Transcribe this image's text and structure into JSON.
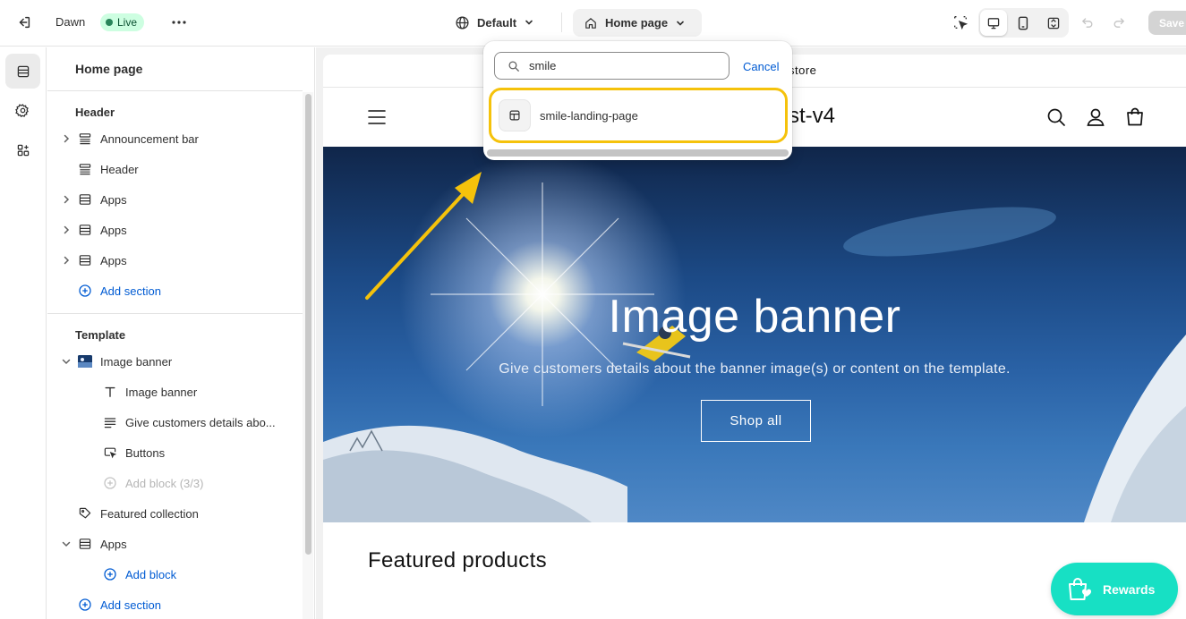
{
  "topbar": {
    "theme_name": "Dawn",
    "status_badge": "Live",
    "locale_label": "Default",
    "page_selector_label": "Home page",
    "save_label": "Save"
  },
  "sidebar": {
    "title": "Home page",
    "header_group": "Header",
    "header_items": [
      {
        "label": "Announcement bar",
        "icon": "section-icon",
        "expandable": true
      },
      {
        "label": "Header",
        "icon": "section-icon",
        "expandable": false
      },
      {
        "label": "Apps",
        "icon": "apps-section-icon",
        "expandable": true
      },
      {
        "label": "Apps",
        "icon": "apps-section-icon",
        "expandable": true
      },
      {
        "label": "Apps",
        "icon": "apps-section-icon",
        "expandable": true
      }
    ],
    "header_add_section": "Add section",
    "template_group": "Template",
    "template_items": [
      {
        "label": "Image banner",
        "icon": "image-thumbnail",
        "expanded": true
      },
      {
        "label": "Image banner",
        "icon": "text-icon",
        "child": true
      },
      {
        "label": "Give customers details abo...",
        "icon": "paragraph-icon",
        "child": true
      },
      {
        "label": "Buttons",
        "icon": "button-cursor-icon",
        "child": true
      },
      {
        "label": "Add block (3/3)",
        "icon": "plus-circle-icon",
        "child": true,
        "disabled": true
      },
      {
        "label": "Featured collection",
        "icon": "tag-icon"
      },
      {
        "label": "Apps",
        "icon": "apps-section-icon",
        "expanded": true
      },
      {
        "label": "Add block",
        "icon": "plus-circle-icon",
        "child": true,
        "link": true
      }
    ],
    "template_add_section": "Add section"
  },
  "dropdown": {
    "search_value": "smile",
    "cancel_label": "Cancel",
    "result_label": "smile-landing-page",
    "highlight_color": "#f5c20b"
  },
  "preview": {
    "announcement_text": "store",
    "store_name": "st-v4",
    "banner_title": "Image banner",
    "banner_subtitle": "Give customers details about the banner image(s) or content on the template.",
    "banner_button": "Shop all",
    "featured_heading": "Featured products",
    "rewards_label": "Rewards",
    "rewards_color": "#17e0c4"
  },
  "colors": {
    "link": "#005bd3",
    "live_badge_bg": "#cdfee1",
    "annotation_arrow": "#f5c20b"
  }
}
